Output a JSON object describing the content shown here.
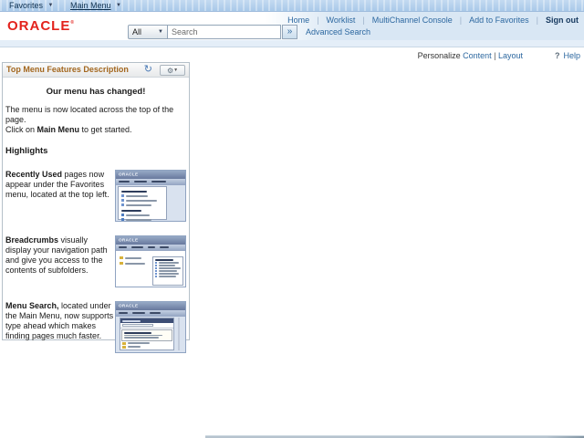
{
  "topbar": {
    "favorites": "Favorites",
    "main_menu": "Main Menu",
    "caret_icon": "▼"
  },
  "banner": {
    "logo": "ORACLE",
    "logo_mark": "®",
    "search_scope": "All",
    "search_placeholder": "Search",
    "go_button": "»",
    "advanced_search": "Advanced Search",
    "separator": "|",
    "links": {
      "home": "Home",
      "worklist": "Worklist",
      "multichannel": "MultiChannel Console",
      "add_to_favorites": "Add to Favorites",
      "sign_out": "Sign out"
    }
  },
  "personalize_bar": {
    "personalize": "Personalize ",
    "content": "Content",
    "separator": " | ",
    "layout": "Layout",
    "help_icon": "?",
    "help": "Help"
  },
  "pagelet": {
    "title": "Top Menu Features Description",
    "refresh_icon": "↻",
    "gear_icon": "⚙",
    "gear_caret": "▼",
    "welcome": "Our menu has changed!",
    "intro_line1": "The menu is now located across the top of the page.",
    "intro_line2_pre": "Click on ",
    "intro_line2_bold": "Main Menu",
    "intro_line2_post": " to get started.",
    "highlights": "Highlights",
    "features": [
      {
        "bold": "Recently Used",
        "text": " pages now appear under the Favorites menu, located at the top left."
      },
      {
        "bold": "Breadcrumbs",
        "text": " visually display your navigation path and give you access to the contents of subfolders."
      },
      {
        "bold": "Menu Search,",
        "text": " located under the Main Menu, now supports type ahead which makes finding pages much faster."
      }
    ]
  },
  "colors": {
    "oracle_red": "#e3231d",
    "link_blue": "#2d68a0",
    "signout_navy": "#16395f",
    "pagelet_title_brown": "#a3671f",
    "topbar_blue": "#b3cfeb"
  }
}
